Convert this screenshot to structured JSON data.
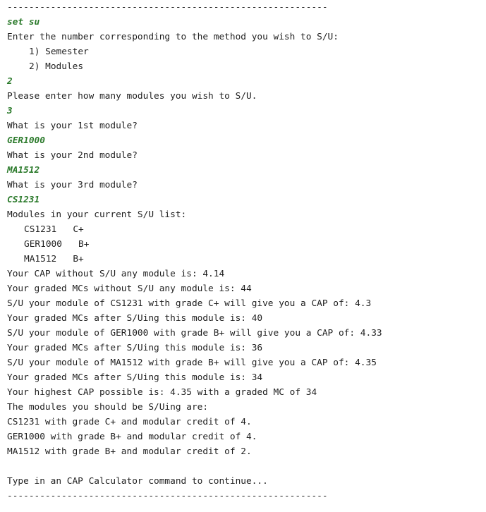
{
  "console": {
    "separator_top": "-----------------------------------------------------------",
    "cmd_set_su": "set su",
    "prompt_method": "Enter the number corresponding to the method you wish to S/U:",
    "method_options": [
      "1) Semester",
      "2) Modules"
    ],
    "input_method": "2",
    "prompt_count": "Please enter how many modules you wish to S/U.",
    "input_count": "3",
    "prompt_mod1": "What is your 1st module?",
    "input_mod1": "GER1000",
    "prompt_mod2": "What is your 2nd module?",
    "input_mod2": "MA1512",
    "prompt_mod3": "What is your 3rd module?",
    "input_mod3": "CS1231",
    "su_list_header": "Modules in your current S/U list:",
    "su_list": [
      "CS1231   C+",
      "GER1000   B+",
      "MA1512   B+"
    ],
    "results": [
      "Your CAP without S/U any module is: 4.14",
      "Your graded MCs without S/U any module is: 44",
      "S/U your module of CS1231 with grade C+ will give you a CAP of: 4.3",
      "Your graded MCs after S/Uing this module is: 40",
      "S/U your module of GER1000 with grade B+ will give you a CAP of: 4.33",
      "Your graded MCs after S/Uing this module is: 36",
      "S/U your module of MA1512 with grade B+ will give you a CAP of: 4.35",
      "Your graded MCs after S/Uing this module is: 34",
      "Your highest CAP possible is: 4.35 with a graded MC of 34",
      "The modules you should be S/Uing are:",
      "CS1231 with grade C+ and modular credit of 4.",
      "GER1000 with grade B+ and modular credit of 4.",
      "MA1512 with grade B+ and modular credit of 2."
    ],
    "continue_prompt": "Type in an CAP Calculator command to continue...",
    "separator_bottom": "-----------------------------------------------------------"
  }
}
